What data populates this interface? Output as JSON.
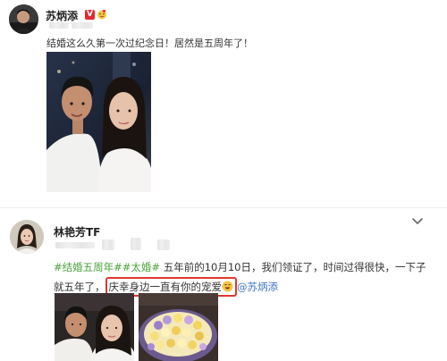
{
  "post1": {
    "author": "苏炳添",
    "verified_badge": "V",
    "text": "结婚这么久第一次过纪念日！居然是五周年了！",
    "photo": "couple-selfie-photo",
    "icons": [
      "verified-icon",
      "heart-face-icon"
    ]
  },
  "post2": {
    "author": "林艳芳TF",
    "hashtag1": "#结婚五周年#",
    "hashtag2": "#太婚#",
    "text_line1_rest": " 五年前的10月10日，我们领证了，时间过得很快，一下子",
    "text_line2_prefix": "就五年了，",
    "highlighted_text": "庆幸身边一直有你的宠爱",
    "mention": "@苏炳添",
    "photos": [
      "couple-selfie-photo",
      "flower-bouquet-photo"
    ],
    "icons": [
      "chevron-down-icon",
      "grin-emoji-icon"
    ],
    "colors": {
      "hashtag": "#4ba33c",
      "mention": "#3d75c4",
      "highlight_border": "#e0382f"
    }
  }
}
